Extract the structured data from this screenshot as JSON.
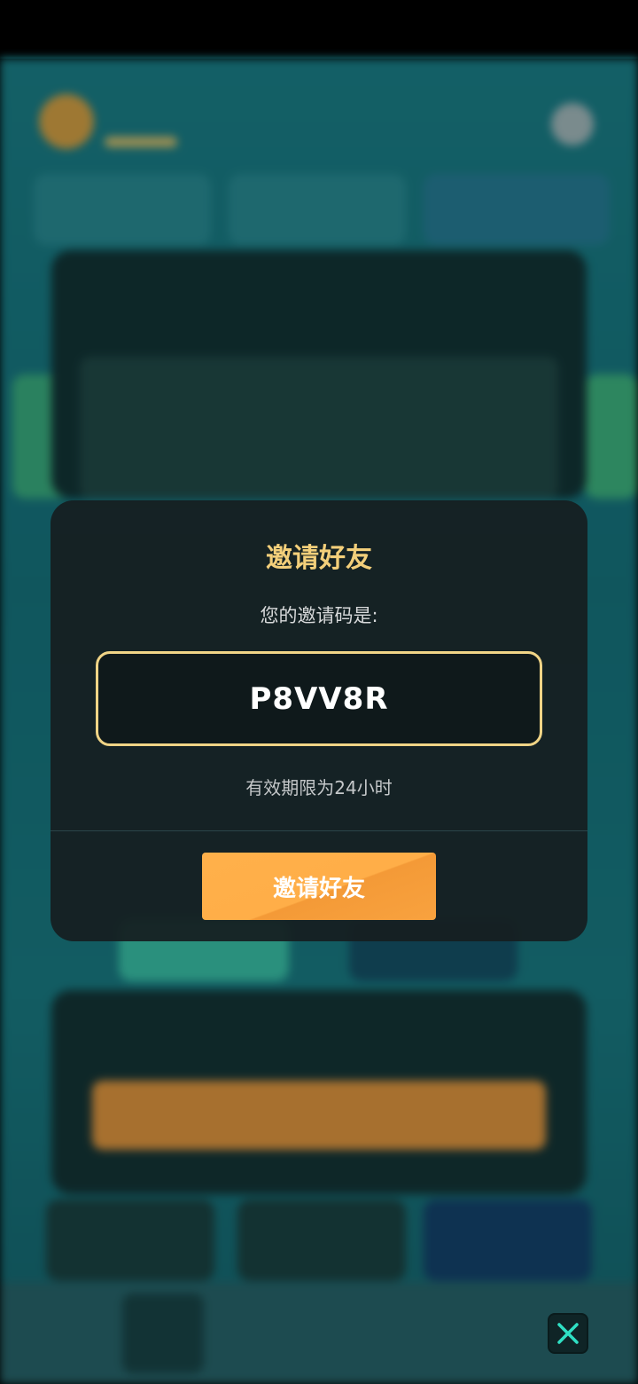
{
  "dialog": {
    "title": "邀请好友",
    "code_label": "您的邀请码是:",
    "code": "P8VV8R",
    "validity": "有效期限为24小时",
    "invite_button_label": "邀请好友"
  },
  "colors": {
    "title": "#f3cf7a",
    "code_border": "#f0d486",
    "button": "#ffae48",
    "close_icon": "#2fe0c4"
  },
  "icons": {
    "close": "close-icon"
  }
}
